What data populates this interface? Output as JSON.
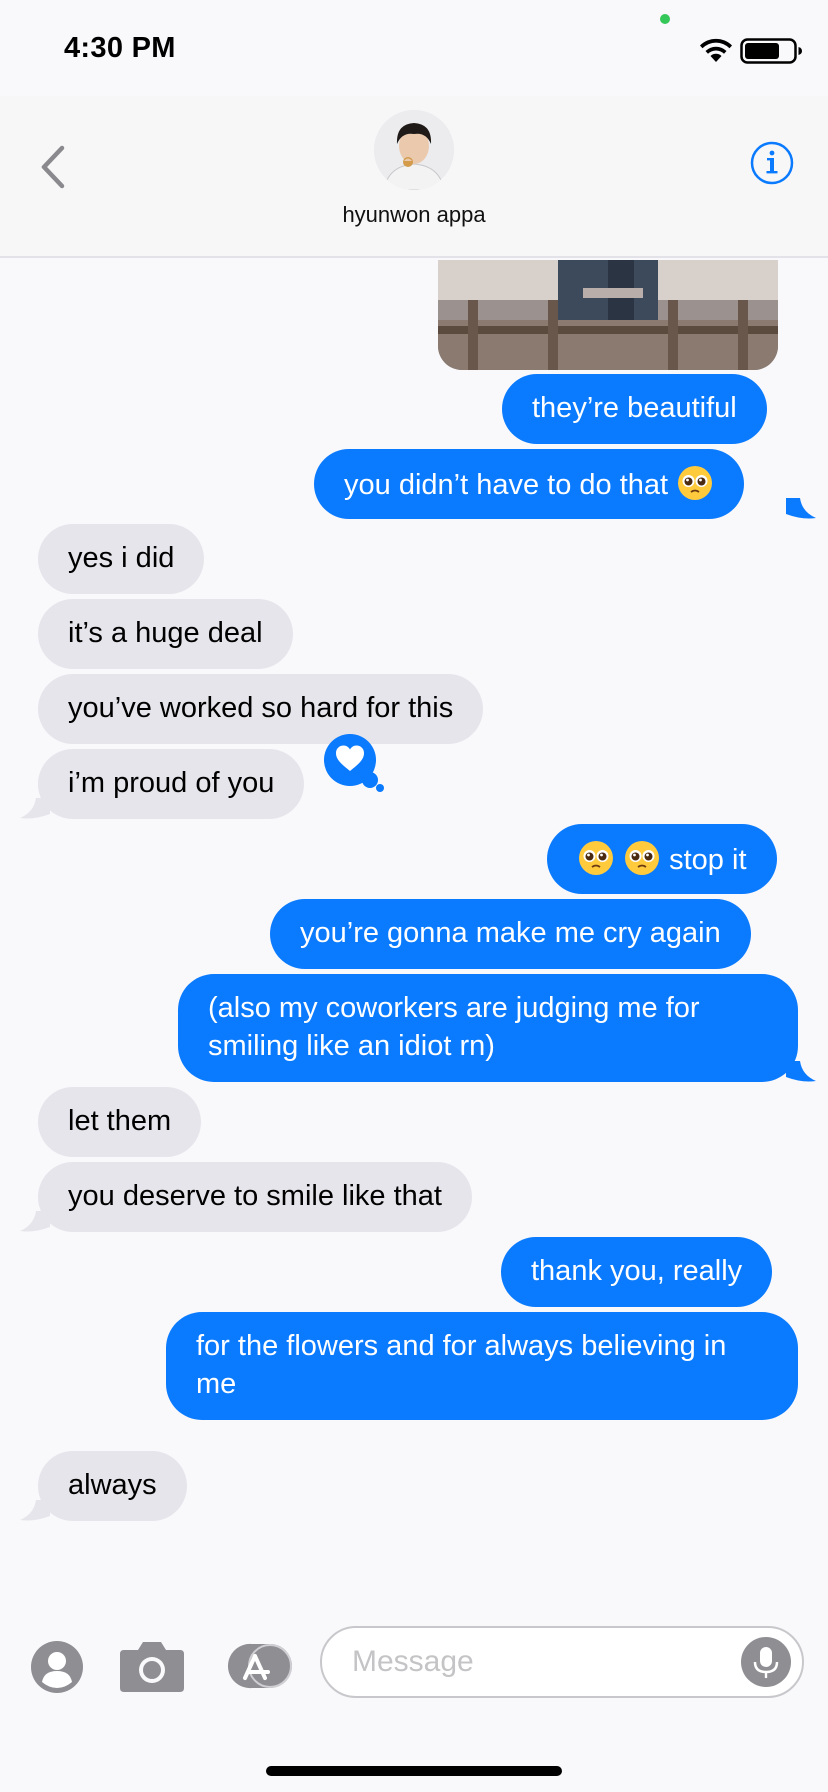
{
  "status_bar": {
    "time": "4:30 PM",
    "indicator_color": "#34c759"
  },
  "header": {
    "back_icon": "chevron-left-icon",
    "contact_name": "hyunwon appa",
    "info_icon": "info-icon"
  },
  "colors": {
    "sent_bubble": "#0a7aff",
    "received_bubble": "#e6e5eb",
    "accent": "#0a7aff"
  },
  "messages": [
    {
      "sender": "me",
      "text": "they’re beautiful"
    },
    {
      "sender": "me",
      "text": "you didn’t have to do that"
    },
    {
      "sender": "them",
      "text": "yes i did"
    },
    {
      "sender": "them",
      "text": "it’s a huge deal"
    },
    {
      "sender": "them",
      "text": "you’ve worked so hard for this"
    },
    {
      "sender": "them",
      "text": "i’m proud of you"
    },
    {
      "sender": "me",
      "text": "stop it"
    },
    {
      "sender": "me",
      "text": "you’re gonna make me cry again"
    },
    {
      "sender": "me",
      "text": "(also my coworkers are judging me for smiling like an idiot rn)"
    },
    {
      "sender": "them",
      "text": "let them"
    },
    {
      "sender": "them",
      "text": "you deserve to smile like that"
    },
    {
      "sender": "me",
      "text": "thank you, really"
    },
    {
      "sender": "me",
      "text": "for the flowers and for always believing in me"
    },
    {
      "sender": "them",
      "text": "always"
    }
  ],
  "reaction": {
    "icon": "heart-icon",
    "on_message": "i’m proud of you"
  },
  "composer": {
    "placeholder": "Message",
    "apps": [
      "memoji-icon",
      "camera-icon",
      "app-store-icon"
    ],
    "mic_icon": "microphone-icon"
  }
}
